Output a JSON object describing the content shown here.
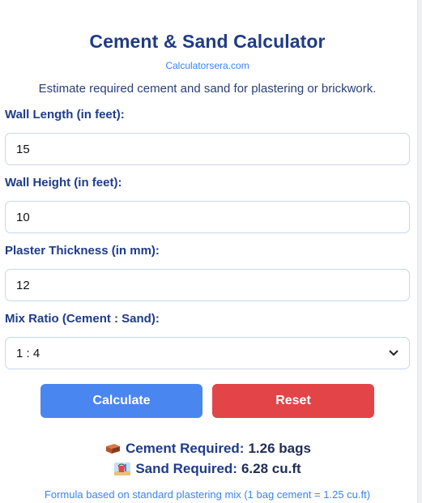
{
  "header": {
    "title": "Cement & Sand Calculator",
    "site": "Calculatorsera.com",
    "description": "Estimate required cement and sand for plastering or brickwork."
  },
  "form": {
    "wall_length_label": "Wall Length (in feet):",
    "wall_length_value": "15",
    "wall_height_label": "Wall Height (in feet):",
    "wall_height_value": "10",
    "plaster_thickness_label": "Plaster Thickness (in mm):",
    "plaster_thickness_value": "12",
    "mix_ratio_label": "Mix Ratio (Cement : Sand):",
    "mix_ratio_selected": "1 : 4"
  },
  "buttons": {
    "calculate": "Calculate",
    "reset": "Reset"
  },
  "results": {
    "cement_icon": "brick-icon",
    "cement_label": "Cement Required:",
    "cement_value": "1.26 bags",
    "sand_icon": "sand-pail-icon",
    "sand_label": "Sand Required:",
    "sand_value": "6.28 cu.ft"
  },
  "footer": {
    "formula_note": "Formula based on standard plastering mix (1 bag cement = 1.25 cu.ft)"
  },
  "colors": {
    "title": "#1f3c88",
    "link": "#3b82f6",
    "calculate_button": "#4a86f0",
    "reset_button": "#e34447"
  }
}
